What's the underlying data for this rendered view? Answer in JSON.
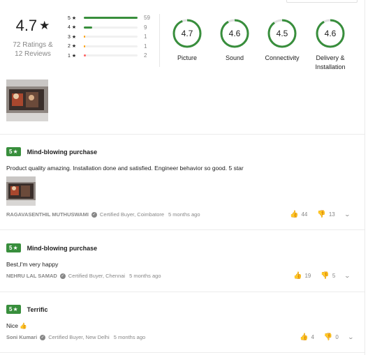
{
  "summary": {
    "average": "4.7",
    "ratings": "72 Ratings &",
    "reviews": "12 Reviews",
    "star_rows": [
      {
        "label": "5 ★",
        "count": "59",
        "fill": 1.0,
        "color": "#388e3c"
      },
      {
        "label": "4 ★",
        "count": "9",
        "fill": 0.15,
        "color": "#388e3c"
      },
      {
        "label": "3 ★",
        "count": "1",
        "fill": 0.02,
        "color": "#ff9f00"
      },
      {
        "label": "2 ★",
        "count": "1",
        "fill": 0.02,
        "color": "#ff9f00"
      },
      {
        "label": "1 ★",
        "count": "2",
        "fill": 0.04,
        "color": "#ff6161"
      }
    ]
  },
  "aspects": [
    {
      "score": "4.7",
      "label": "Picture",
      "value": 4.7
    },
    {
      "score": "4.6",
      "label": "Sound",
      "value": 4.6
    },
    {
      "score": "4.5",
      "label": "Connectivity",
      "value": 4.5
    },
    {
      "score": "4.6",
      "label": "Delivery &",
      "label2": "Installation",
      "value": 4.6
    }
  ],
  "reviews": [
    {
      "rating": "5",
      "title": "Mind-blowing purchase",
      "body": "Product quality amazing. Installation done and satisfied. Engineer behavior so good. 5 star",
      "author": "RAGAVASENTHIL MUTHUSWAMI",
      "certified": "Certified Buyer, Coimbatore",
      "time": "5 months ago",
      "likes": "44",
      "dislikes": "13"
    },
    {
      "rating": "5",
      "title": "Mind-blowing purchase",
      "body": "Best,I'm very happy",
      "author": "NEHRU LAL SAMAD",
      "certified": "Certified Buyer, Chennai",
      "time": "5 months ago",
      "likes": "19",
      "dislikes": "5"
    },
    {
      "rating": "5",
      "title": "Terrific",
      "body": "Nice 👍",
      "author": "Soni Kumari",
      "certified": "Certified Buyer, New Delhi",
      "time": "5 months ago",
      "likes": "4",
      "dislikes": "0"
    }
  ],
  "icons": {
    "like": "thumbs-up-icon",
    "dislike": "thumbs-down-icon",
    "expand": "chevron-down-icon",
    "certified": "check-circle-icon"
  },
  "colors": {
    "accent": "#388e3c",
    "muted": "#878787"
  }
}
